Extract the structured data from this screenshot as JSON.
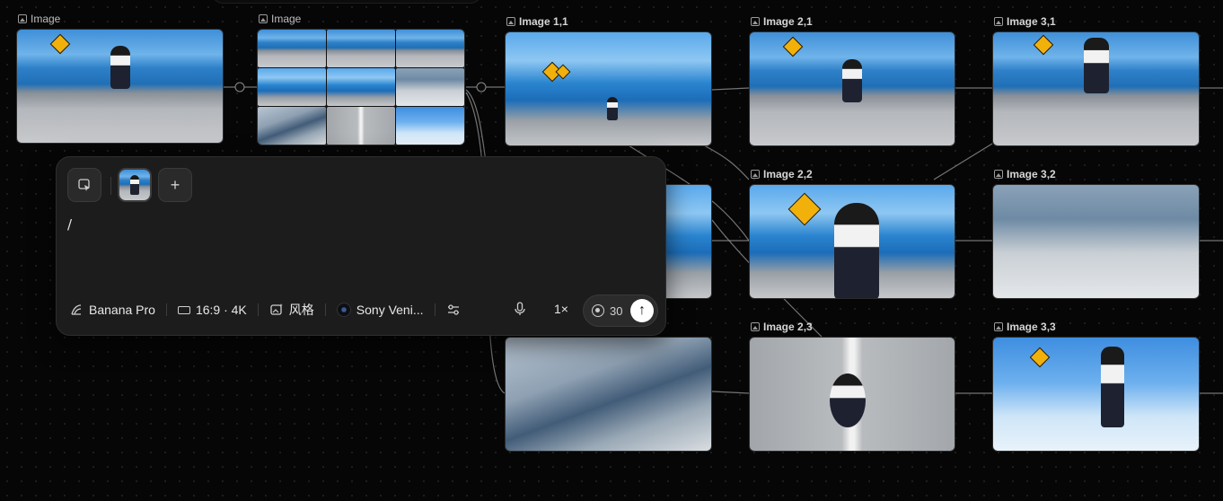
{
  "source_nodes": [
    {
      "label": "Image",
      "scene": "road"
    },
    {
      "label": "Image",
      "scene": "collage"
    }
  ],
  "grid_nodes": [
    {
      "label": "Image 1,1",
      "scene": "side"
    },
    {
      "label": "Image 2,1",
      "scene": "road"
    },
    {
      "label": "Image 3,1",
      "scene": "road"
    },
    {
      "label": "Image 2,2",
      "scene": "side"
    },
    {
      "label": "Image 3,2",
      "scene": "wheel"
    },
    {
      "label": "Image 2,3",
      "scene": "top"
    },
    {
      "label": "Image 3,3",
      "scene": "sky"
    }
  ],
  "prompt_panel": {
    "prompt_text": "/",
    "add_label": "+",
    "model": "Banana Pro",
    "aspect": "16:9 · 4K",
    "style": "风格",
    "camera": "Sony Veni...",
    "multiplier": "1×",
    "credits": "30",
    "send_glyph": "↑"
  },
  "colors": {
    "background": "#060606",
    "panel": "#1c1c1c",
    "accent_sign": "#f1b00a",
    "sea_blue": "#1f6fb6"
  },
  "icons": [
    "image-icon",
    "selection-icon",
    "plus-icon",
    "model-icon",
    "aspect-ratio-icon",
    "style-icon",
    "camera-lens-icon",
    "settings-sliders-icon",
    "microphone-icon",
    "credit-icon",
    "arrow-up-icon"
  ]
}
